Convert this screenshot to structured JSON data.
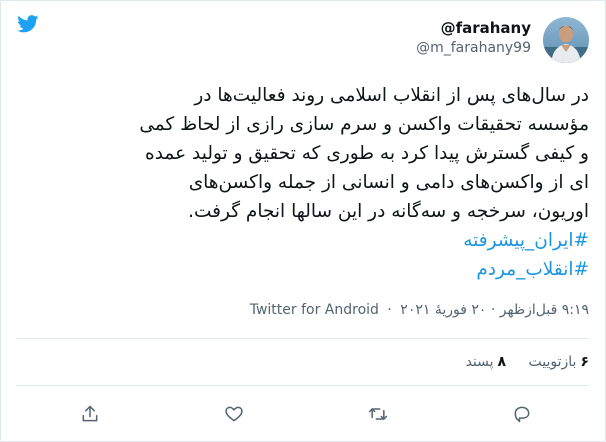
{
  "tweet": {
    "display_name": "@farahany",
    "handle": "@m_farahany99",
    "body_lines": [
      "در سال‌های پس از انقلاب اسلامی روند فعالیت‌ها در",
      "مؤسسه تحقیقات واکسن و سرم سازی رازی از لحاظ کمی",
      "و کیفی گسترش پیدا کرد به طوری که تحقیق و تولید عمده",
      "ای از واکسن‌های دامی و انسانی از جمله واکسن‌های",
      "اوریون، سرخجه و سه‌گانه در این سالها انجام گرفت."
    ],
    "hashtags": [
      "#ایران_پیشرفته",
      "#انقلاب_مردم"
    ],
    "timestamp": "۹:۱۹ قبل‌ازظهر · ۲۰ فوریهٔ ۲۰۲۱",
    "separator": "·",
    "source": "Twitter for Android",
    "retweets_count": "۶",
    "retweets_label": "بازتوییت",
    "likes_count": "۸",
    "likes_label": "پسند"
  },
  "icons": {
    "logo": "twitter-bird-icon",
    "avatar": "profile-photo",
    "actions": [
      "share-icon",
      "like-icon",
      "retweet-icon",
      "reply-icon"
    ]
  },
  "colors": {
    "hashtag": "#1b95e0",
    "brand": "#1da1f2",
    "secondary_text": "#536471"
  }
}
